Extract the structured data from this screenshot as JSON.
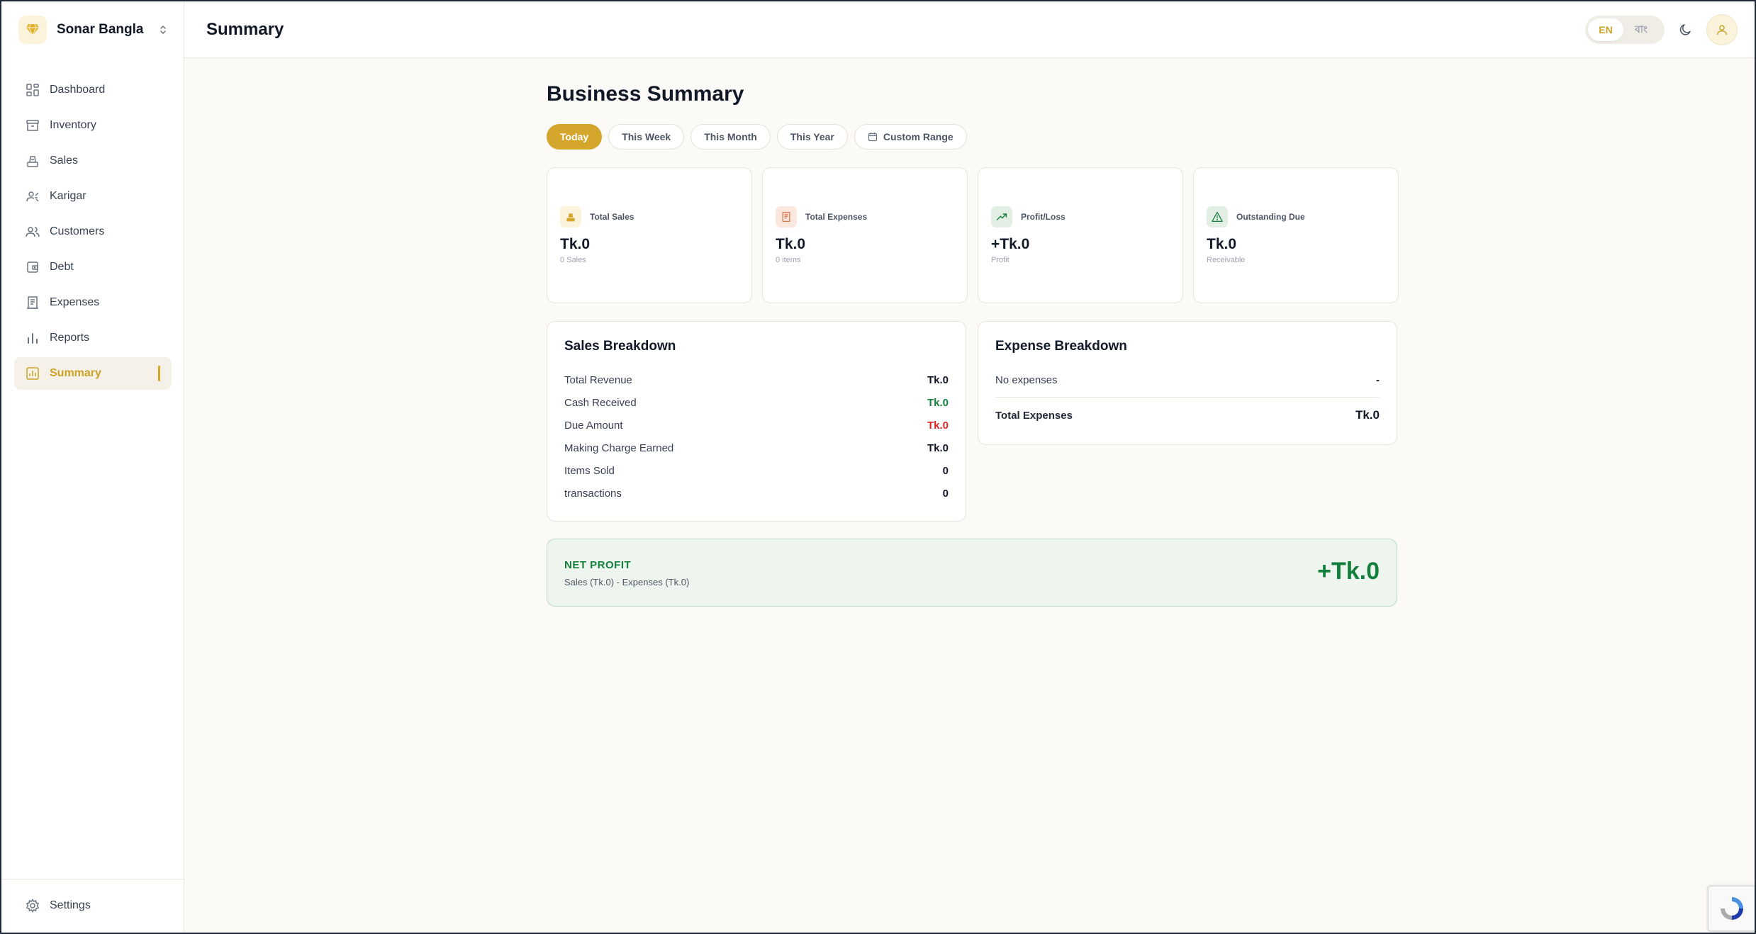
{
  "brand": {
    "name": "Sonar Bangla"
  },
  "sidebar": {
    "items": [
      {
        "label": "Dashboard",
        "icon": "grid-icon"
      },
      {
        "label": "Inventory",
        "icon": "box-icon"
      },
      {
        "label": "Sales",
        "icon": "scale-icon"
      },
      {
        "label": "Karigar",
        "icon": "user-tool-icon"
      },
      {
        "label": "Customers",
        "icon": "users-icon"
      },
      {
        "label": "Debt",
        "icon": "wallet-icon"
      },
      {
        "label": "Expenses",
        "icon": "receipt-icon"
      },
      {
        "label": "Reports",
        "icon": "bar-chart-icon"
      },
      {
        "label": "Summary",
        "icon": "chart-box-icon",
        "active": true
      }
    ],
    "settings_label": "Settings"
  },
  "header": {
    "title": "Summary",
    "lang": {
      "en": "EN",
      "bn": "বাং",
      "selected": "EN"
    }
  },
  "main": {
    "title": "Business Summary",
    "ranges": [
      {
        "label": "Today",
        "selected": true
      },
      {
        "label": "This Week"
      },
      {
        "label": "This Month"
      },
      {
        "label": "This Year"
      },
      {
        "label": "Custom Range"
      }
    ],
    "stats": [
      {
        "label": "Total Sales",
        "value": "Tk.0",
        "sub": "0 Sales"
      },
      {
        "label": "Total Expenses",
        "value": "Tk.0",
        "sub": "0 items"
      },
      {
        "label": "Profit/Loss",
        "value": "+Tk.0",
        "sub": "Profit"
      },
      {
        "label": "Outstanding Due",
        "value": "Tk.0",
        "sub": "Receivable"
      }
    ],
    "sales_breakdown": {
      "title": "Sales Breakdown",
      "rows": [
        {
          "label": "Total Revenue",
          "value": "Tk.0"
        },
        {
          "label": "Cash Received",
          "value": "Tk.0"
        },
        {
          "label": "Due Amount",
          "value": "Tk.0"
        },
        {
          "label": "Making Charge Earned",
          "value": "Tk.0"
        },
        {
          "label": "Items Sold",
          "value": "0"
        },
        {
          "label": "transactions",
          "value": "0"
        }
      ]
    },
    "expense_breakdown": {
      "title": "Expense Breakdown",
      "empty_label": "No expenses",
      "empty_value": "-",
      "total_label": "Total Expenses",
      "total_value": "Tk.0"
    },
    "net_profit": {
      "label": "NET PROFIT",
      "formula": "Sales (Tk.0) - Expenses (Tk.0)",
      "value": "+Tk.0"
    }
  },
  "colors": {
    "accent": "#d4a72c",
    "positive": "#15803d",
    "negative": "#dc2626"
  }
}
